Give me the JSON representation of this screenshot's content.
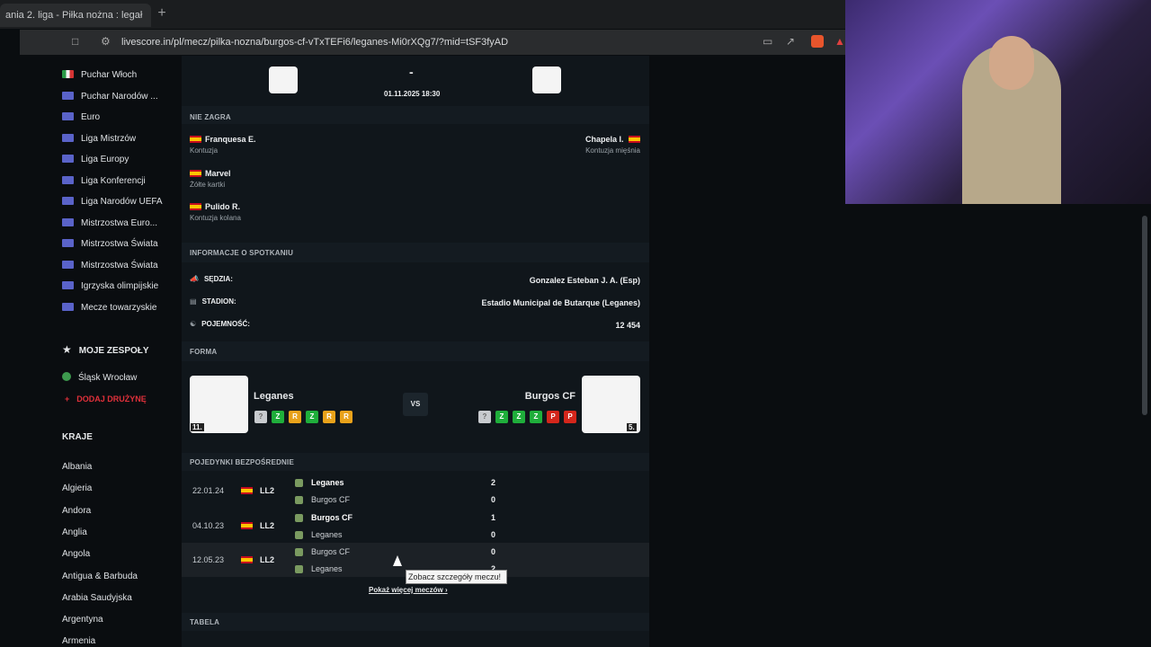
{
  "browser": {
    "tab_title": "ania 2. liga - Piłka nożna : legał",
    "url": "livescore.in/pl/mecz/pilka-nozna/burgos-cf-vTxTEFi6/leganes-Mi0rXQg7/?mid=tSF3fyAD"
  },
  "sidebar": {
    "leagues": [
      "Puchar Włoch",
      "Puchar Narodów ...",
      "Euro",
      "Liga Mistrzów",
      "Liga Europy",
      "Liga Konferencji",
      "Liga Narodów UEFA",
      "Mistrzostwa Euro...",
      "Mistrzostwa Świata",
      "Mistrzostwa Świata",
      "Igrzyska olimpijskie",
      "Mecze towarzyskie"
    ],
    "my_teams_label": "MOJE ZESPOŁY",
    "team": "Śląsk Wrocław",
    "add_team": "DODAJ DRUŻYNĘ",
    "countries_label": "KRAJE",
    "countries": [
      "Albania",
      "Algieria",
      "Andora",
      "Anglia",
      "Angola",
      "Antigua & Barbuda",
      "Arabia Saudyjska",
      "Argentyna",
      "Armenia"
    ]
  },
  "match": {
    "score_dash": "-",
    "datetime": "01.11.2025 18:30"
  },
  "absent": {
    "title": "NIE ZAGRA",
    "home": [
      {
        "name": "Franquesa E.",
        "reason": "Kontuzja"
      },
      {
        "name": "Marvel",
        "reason": "Żółte kartki"
      },
      {
        "name": "Pulido R.",
        "reason": "Kontuzja kolana"
      }
    ],
    "away": [
      {
        "name": "Chapela I.",
        "reason": "Kontuzja mięśnia"
      }
    ]
  },
  "info": {
    "title": "INFORMACJE O SPOTKANIU",
    "referee_label": "SĘDZIA:",
    "referee": "Gonzalez Esteban J. A. (Esp)",
    "stadium_label": "STADION:",
    "stadium": "Estadio Municipal de Butarque (Leganes)",
    "capacity_label": "POJEMNOŚĆ:",
    "capacity": "12 454"
  },
  "form": {
    "title": "FORMA",
    "home": {
      "name": "Leganes",
      "rank": "11.",
      "badges": [
        "?",
        "Z",
        "R",
        "Z",
        "R",
        "R"
      ]
    },
    "vs": "VS",
    "away": {
      "name": "Burgos CF",
      "rank": "5.",
      "badges": [
        "?",
        "Z",
        "Z",
        "Z",
        "P",
        "P"
      ]
    }
  },
  "h2h": {
    "title": "POJEDYNKI BEZPOŚREDNIE",
    "rows": [
      {
        "date": "22.01.24",
        "league": "LL2",
        "team1": "Leganes",
        "score1": "2",
        "team2": "Burgos CF",
        "score2": "0"
      },
      {
        "date": "04.10.23",
        "league": "LL2",
        "team1": "Burgos CF",
        "score1": "1",
        "team2": "Leganes",
        "score2": "0"
      },
      {
        "date": "12.05.23",
        "league": "LL2",
        "team1": "Burgos CF",
        "score1": "0",
        "team2": "Leganes",
        "score2": "2"
      }
    ],
    "more": "Pokaż więcej meczów",
    "tooltip": "Zobacz szczegóły meczu!"
  },
  "table": {
    "title": "TABELA"
  },
  "colors": {
    "win": "#1fae3b",
    "draw": "#e9a21a",
    "loss": "#d4261b",
    "add_team": "#e0303a"
  }
}
